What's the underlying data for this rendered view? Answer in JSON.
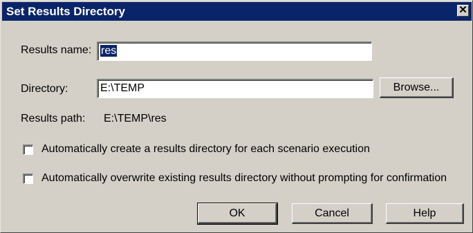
{
  "dialog": {
    "title": "Set Results Directory",
    "close_icon": "close-icon",
    "close_glyph": "✕"
  },
  "results_name": {
    "label": "Results name:",
    "value": "res"
  },
  "directory": {
    "label": "Directory:",
    "value": "E:\\TEMP",
    "browse_label": "Browse..."
  },
  "results_path": {
    "label": "Results path:",
    "value": "E:\\TEMP\\res"
  },
  "options": [
    {
      "label": "Automatically create a results directory for each scenario execution",
      "checked": false
    },
    {
      "label": "Automatically overwrite existing results directory without prompting for confirmation",
      "checked": false
    }
  ],
  "buttons": {
    "ok": "OK",
    "cancel": "Cancel",
    "help": "Help"
  },
  "colors": {
    "titlebar": "#0a246a",
    "face": "#d4d0c8"
  }
}
